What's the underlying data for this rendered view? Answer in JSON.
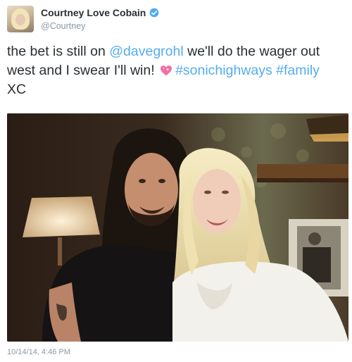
{
  "tweet": {
    "display_name": "Courtney Love Cobain",
    "handle": "@Courtney",
    "text_1": "the bet is still on ",
    "mention": "@davegrohl",
    "text_2": " we'll do the wager out west and I swear I'll win!",
    "hashtag_1": "#sonichighways",
    "hashtag_2": "#family",
    "signoff": "XC",
    "timestamp": "10/14/14, 4:46 PM"
  },
  "icons": {
    "verified": "verified-badge-icon",
    "heart": "sparkling-heart-emoji"
  },
  "colors": {
    "link": "#55acee",
    "text": "#292f33",
    "muted": "#8899a6"
  }
}
